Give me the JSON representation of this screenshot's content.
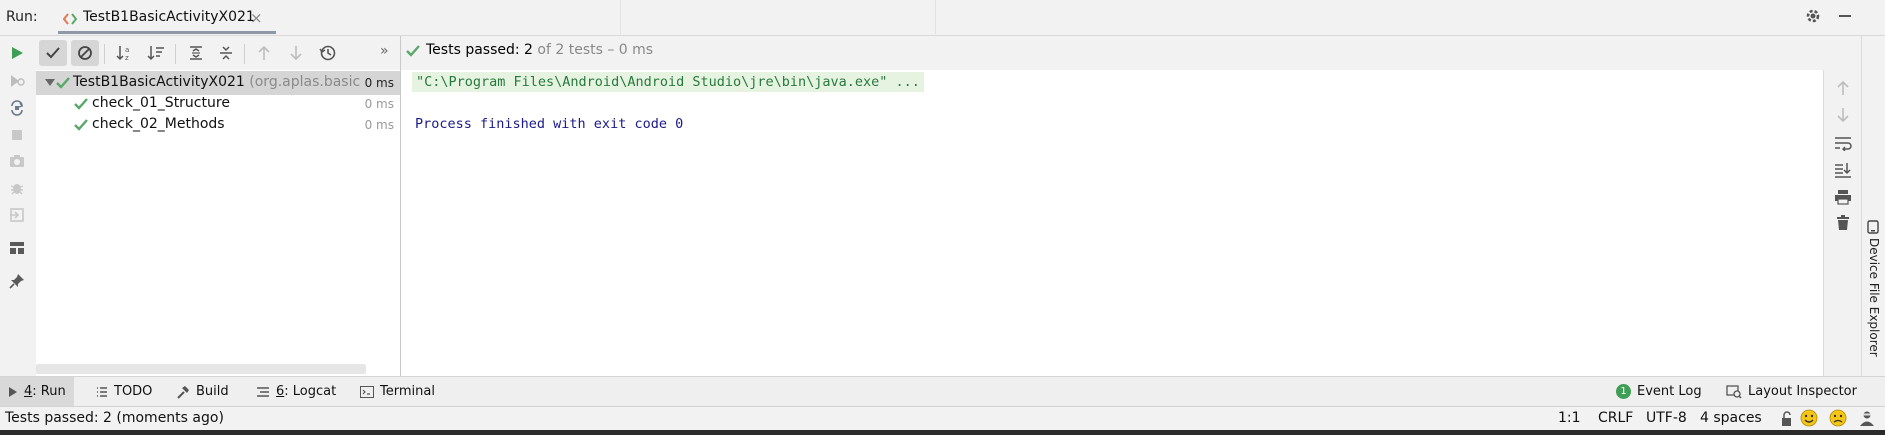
{
  "header": {
    "run_label": "Run:",
    "tab_title": "TestB1BasicActivityX021",
    "tab_close": "×"
  },
  "status": {
    "chevron": "»",
    "passed_label": "Tests passed: ",
    "passed_count": "2",
    "passed_rest": " of 2 tests – 0 ms"
  },
  "tree": {
    "root": {
      "name": "TestB1BasicActivityX021",
      "package": " (org.aplas.basica",
      "time": "0 ms"
    },
    "items": [
      {
        "name": "check_01_Structure",
        "time": "0 ms"
      },
      {
        "name": "check_02_Methods",
        "time": "0 ms"
      }
    ]
  },
  "console": {
    "command_line": "\"C:\\Program Files\\Android\\Android Studio\\jre\\bin\\java.exe\" ...",
    "exit_line": "Process finished with exit code 0"
  },
  "right_stripe": {
    "device_file_explorer": "Device File Explorer"
  },
  "bottom_tabs": {
    "run_num": "4",
    "run_label": ": Run",
    "todo": "TODO",
    "build": "Build",
    "logcat_num": "6",
    "logcat_label": ": Logcat",
    "terminal": "Terminal",
    "event_log_badge": "1",
    "event_log": "Event Log",
    "layout_inspector": "Layout Inspector"
  },
  "status_bar": {
    "message": "Tests passed: 2 (moments ago)",
    "position": "1:1",
    "line_sep": "CRLF",
    "encoding": "UTF-8",
    "indent": "4 spaces"
  },
  "colors": {
    "success_green": "#59a869",
    "run_green": "#3f9e55",
    "console_cmd_bg": "#e6f3e1",
    "console_cmd_text": "#277a3e",
    "console_text": "#1a1a8c"
  }
}
